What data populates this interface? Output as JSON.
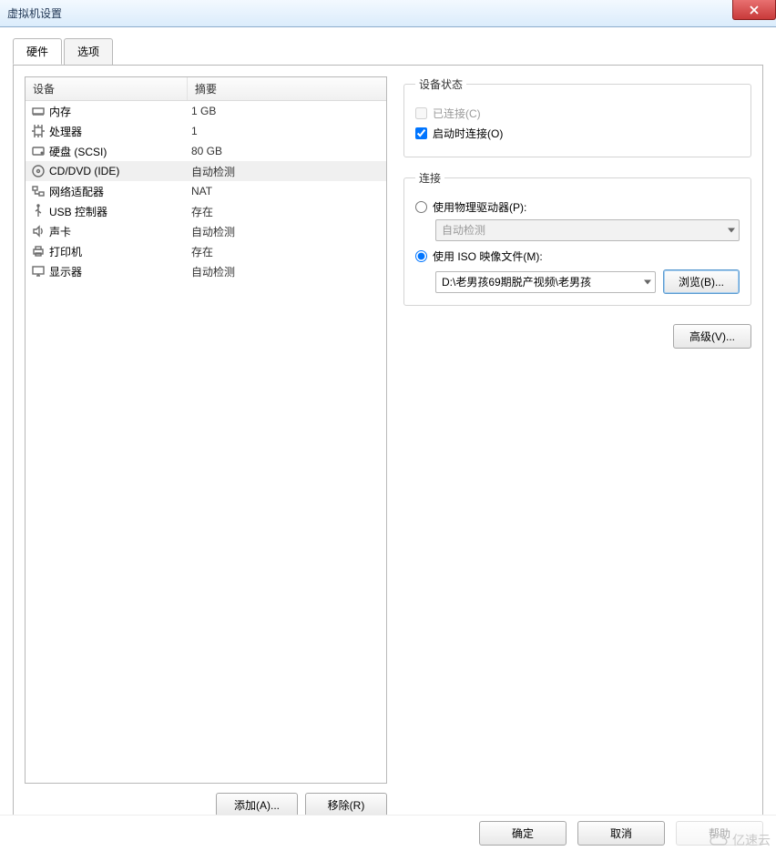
{
  "window": {
    "title": "虚拟机设置"
  },
  "tabs": {
    "hardware": "硬件",
    "options": "选项"
  },
  "deviceList": {
    "headers": {
      "device": "设备",
      "summary": "摘要"
    },
    "rows": [
      {
        "name": "内存",
        "summary": "1 GB",
        "icon": "memory-icon"
      },
      {
        "name": "处理器",
        "summary": "1",
        "icon": "cpu-icon"
      },
      {
        "name": "硬盘 (SCSI)",
        "summary": "80 GB",
        "icon": "disk-icon"
      },
      {
        "name": "CD/DVD (IDE)",
        "summary": "自动检测",
        "icon": "cd-icon",
        "selected": true
      },
      {
        "name": "网络适配器",
        "summary": "NAT",
        "icon": "network-icon"
      },
      {
        "name": "USB 控制器",
        "summary": "存在",
        "icon": "usb-icon"
      },
      {
        "name": "声卡",
        "summary": "自动检测",
        "icon": "sound-icon"
      },
      {
        "name": "打印机",
        "summary": "存在",
        "icon": "printer-icon"
      },
      {
        "name": "显示器",
        "summary": "自动检测",
        "icon": "display-icon"
      }
    ]
  },
  "leftButtons": {
    "add": "添加(A)...",
    "remove": "移除(R)"
  },
  "rightPanel": {
    "deviceStatus": {
      "legend": "设备状态",
      "connected": "已连接(C)",
      "connectAtPowerOn": "启动时连接(O)"
    },
    "connection": {
      "legend": "连接",
      "usePhysical": "使用物理驱动器(P):",
      "physicalValue": "自动检测",
      "useIso": "使用 ISO 映像文件(M):",
      "isoPath": "D:\\老男孩69期脱产视频\\老男孩",
      "browse": "浏览(B)..."
    },
    "advanced": "高级(V)..."
  },
  "bottom": {
    "ok": "确定",
    "cancel": "取消",
    "help": "帮助"
  },
  "watermark": "亿速云"
}
